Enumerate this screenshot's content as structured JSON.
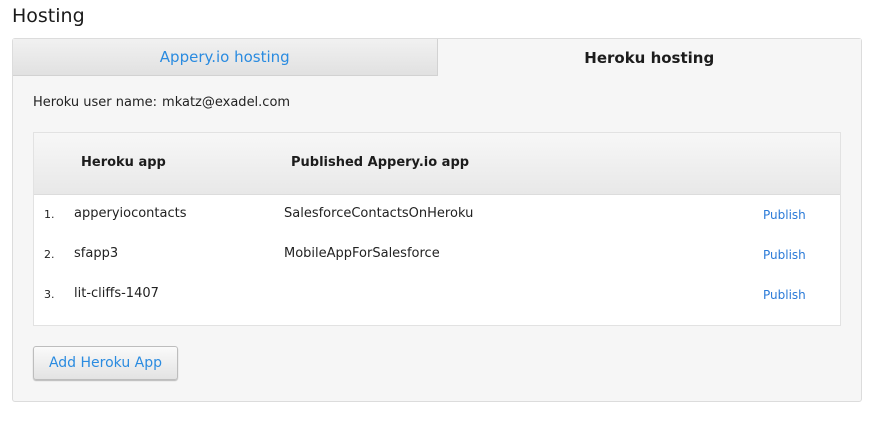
{
  "page": {
    "title": "Hosting"
  },
  "tabs": [
    {
      "label": "Appery.io hosting",
      "active": false
    },
    {
      "label": "Heroku hosting",
      "active": true
    }
  ],
  "user": {
    "label": "Heroku user name:",
    "value": "mkatz@exadel.com"
  },
  "table": {
    "headers": {
      "app": "Heroku app",
      "published": "Published Appery.io app"
    },
    "rows": [
      {
        "num": "1.",
        "app": "apperyiocontacts",
        "published": "SalesforceContactsOnHeroku",
        "action": "Publish"
      },
      {
        "num": "2.",
        "app": "sfapp3",
        "published": "MobileAppForSalesforce",
        "action": "Publish"
      },
      {
        "num": "3.",
        "app": "lit-cliffs-1407",
        "published": "",
        "action": "Publish"
      }
    ]
  },
  "actions": {
    "add_label": "Add Heroku App"
  },
  "colors": {
    "link": "#2a7ad8",
    "tab_link": "#2a8be0"
  }
}
